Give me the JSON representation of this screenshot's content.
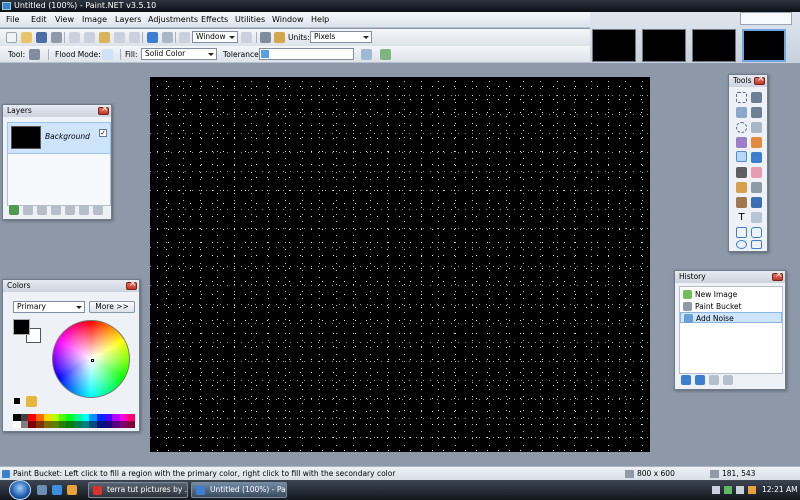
{
  "window": {
    "title": "Untitled (100%) - Paint.NET v3.5.10"
  },
  "menu": [
    "File",
    "Edit",
    "View",
    "Image",
    "Layers",
    "Adjustments",
    "Effects",
    "Utilities",
    "Window",
    "Help"
  ],
  "toolbar1": {
    "window_combo": "Window",
    "units_label": "Units:",
    "units_value": "Pixels"
  },
  "toolbar2": {
    "tool_label": "Tool:",
    "flood_mode_label": "Flood Mode:",
    "fill_label": "Fill:",
    "fill_value": "Solid Color",
    "tolerance_label": "Tolerance:"
  },
  "layers": {
    "title": "Layers",
    "items": [
      {
        "name": "Background",
        "visible": true
      }
    ]
  },
  "colors": {
    "title": "Colors",
    "mode": "Primary",
    "more_label": "More >>",
    "primary_color": "#000000",
    "secondary_color": "#ffffff",
    "palette": [
      "#000000",
      "#404040",
      "#ff0000",
      "#ff6a00",
      "#ffd800",
      "#b6ff00",
      "#4cff00",
      "#00ff21",
      "#00ff90",
      "#00ffff",
      "#0094ff",
      "#0026ff",
      "#4800ff",
      "#b200ff",
      "#ff00dc",
      "#ff006e",
      "#ffffff",
      "#808080",
      "#7f0000",
      "#7f3300",
      "#7f6a00",
      "#5b7f00",
      "#267f00",
      "#007f0e",
      "#007f46",
      "#007f7f",
      "#004a7f",
      "#00137f",
      "#21007f",
      "#57007f",
      "#7f006e",
      "#7f0037"
    ]
  },
  "tools": {
    "title": "Tools",
    "selected": "paint-bucket"
  },
  "history": {
    "title": "History",
    "items": [
      {
        "label": "New Image"
      },
      {
        "label": "Paint Bucket"
      },
      {
        "label": "Add Noise"
      }
    ],
    "selected": "Add Noise"
  },
  "status": {
    "text": "Paint Bucket: Left click to fill a region with the primary color, right click to fill with the secondary color",
    "image_size": "800 x 600",
    "cursor": "181, 543"
  },
  "taskbar": {
    "tasks": [
      {
        "label": "terra tut pictures by ..."
      },
      {
        "label": "Untitled (100%) - Pa..."
      }
    ],
    "time": "12:21 AM"
  }
}
